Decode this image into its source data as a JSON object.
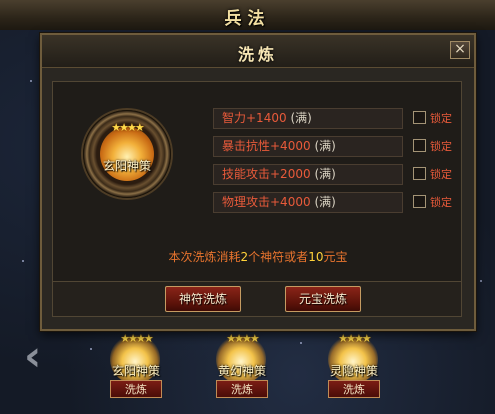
{
  "background_window": {
    "title": "兵法",
    "skills": [
      {
        "name": "玄阳神策",
        "stars": "★★★★",
        "button": "洗炼"
      },
      {
        "name": "黄幻神策",
        "stars": "★★★★",
        "button": "洗炼"
      },
      {
        "name": "灵隐神策",
        "stars": "★★★★",
        "button": "洗炼"
      }
    ]
  },
  "dialog": {
    "title": "洗炼",
    "close_symbol": "×",
    "emblem": {
      "name": "玄阳神策",
      "stars": "★★★★"
    },
    "attributes": [
      {
        "name": "智力+1400",
        "status": "(满)",
        "lock_label": "锁定",
        "locked": false
      },
      {
        "name": "暴击抗性+4000",
        "status": "(满)",
        "lock_label": "锁定",
        "locked": false
      },
      {
        "name": "技能攻击+2000",
        "status": "(满)",
        "lock_label": "锁定",
        "locked": false
      },
      {
        "name": "物理攻击+4000",
        "status": "(满)",
        "lock_label": "锁定",
        "locked": false
      }
    ],
    "cost": {
      "part1": "本次洗炼消耗",
      "amount1": "2",
      "part2": "个神符或者",
      "amount2": "10",
      "part3": "元宝"
    },
    "buttons": {
      "talisman": "神符洗炼",
      "ingot": "元宝洗炼"
    }
  },
  "colors": {
    "attribute_text": "#e85a3a",
    "highlight": "#ffd23a",
    "button_red": "#7a1d14"
  }
}
